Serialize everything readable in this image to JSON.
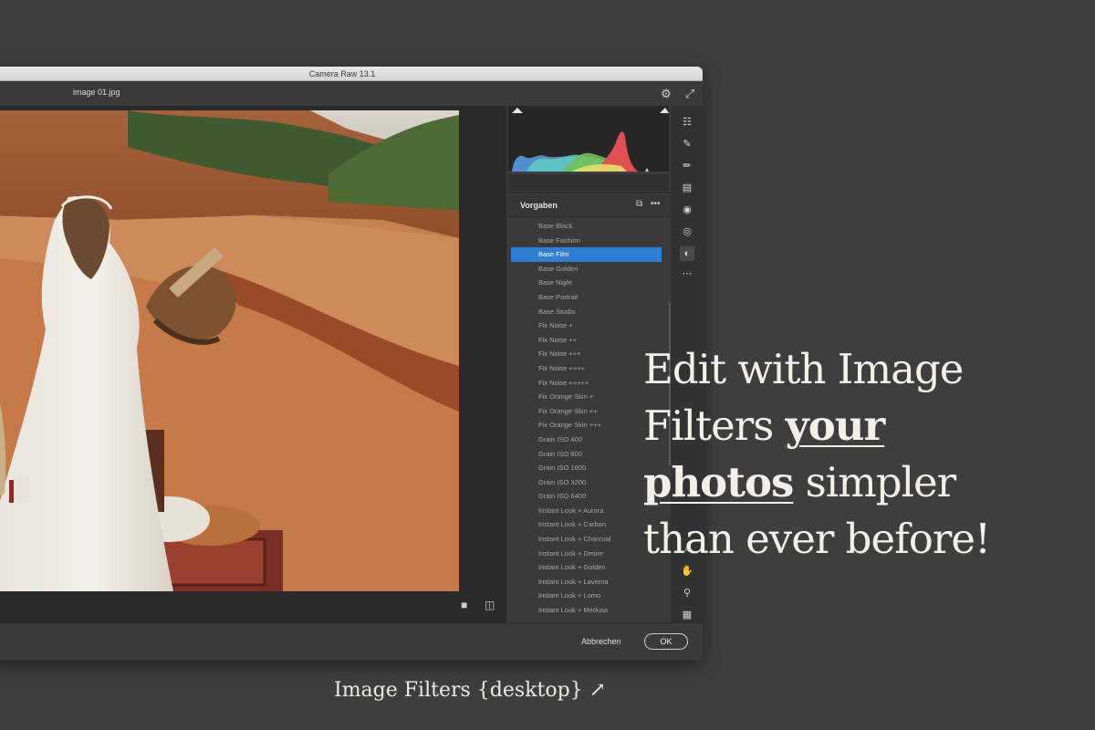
{
  "window": {
    "title": "Camera Raw 13.1",
    "filename": "image 01.jpg",
    "settings_icon": "gear-icon",
    "expand_icon": "expand-icon"
  },
  "panel": {
    "presets_title": "Vorgaben",
    "presets": [
      "Base Black",
      "Base Fashion",
      "Base Film",
      "Base Golden",
      "Base Night",
      "Base Portrait",
      "Base Studio",
      "Fix Noise +",
      "Fix Noise ++",
      "Fix Noise +++",
      "Fix Noise ++++",
      "Fix Noise +++++",
      "Fix Orange Skin +",
      "Fix Orange Skin ++",
      "Fix Orange Skin +++",
      "Grain ISO 400",
      "Grain ISO 800",
      "Grain ISO 1600",
      "Grain ISO 3200",
      "Grain ISO 6400",
      "Instant Look + Aurora",
      "Instant Look + Carbon",
      "Instant Look + Charcoal",
      "Instant Look + Desire",
      "Instant Look + Golden",
      "Instant Look + Laverna",
      "Instant Look + Lomo",
      "Instant Look + Medusa"
    ],
    "selected_preset": "Base Film"
  },
  "footer": {
    "cancel_label": "Abbrechen",
    "ok_label": "OK"
  },
  "promo": {
    "line1": "Edit with Image",
    "line2_a": "Filters ",
    "line2_em": "your",
    "line3_em": "photos",
    "line3_b": " simpler",
    "line4": "than ever before!",
    "link": "Image Filters {desktop} ↗"
  },
  "colors": {
    "selection": "#2d80d6",
    "background": "#3e3e3e"
  }
}
